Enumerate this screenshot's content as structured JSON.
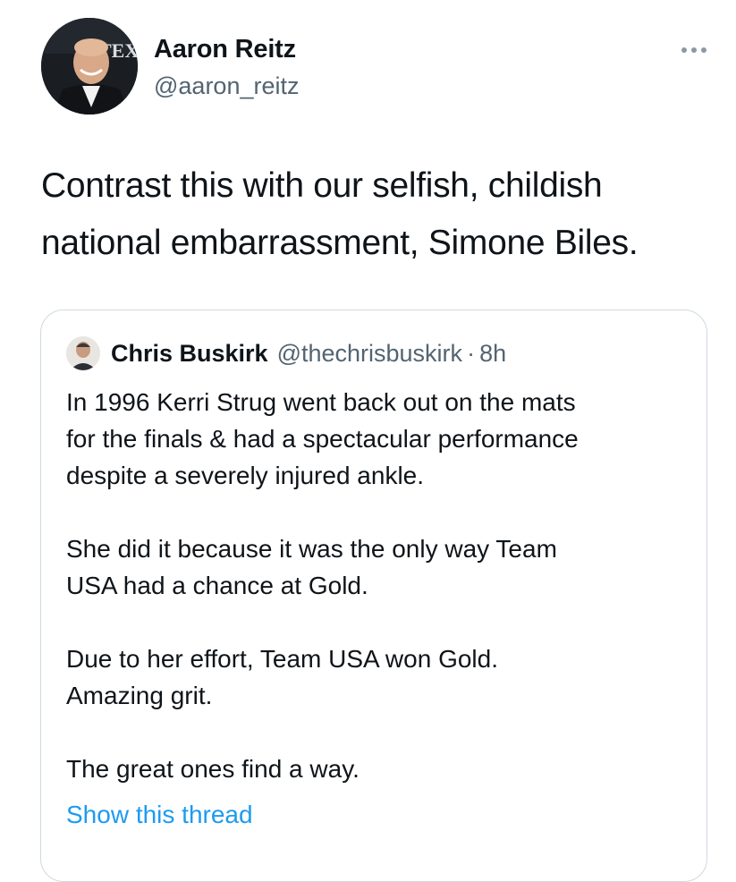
{
  "author": {
    "display_name": "Aaron Reitz",
    "handle": "@aaron_reitz",
    "avatar_backdrop_text": "TEX"
  },
  "more_icon": "more-horizontal-icon",
  "tweet": {
    "lines": [
      "Contrast this with our selfish, childish",
      "national embarrassment, Simone Biles."
    ]
  },
  "quoted_tweet": {
    "display_name": "Chris Buskirk",
    "handle": "@thechrisbuskirk",
    "separator": "·",
    "time": "8h",
    "paragraphs": [
      {
        "lines": [
          "In 1996 Kerri Strug went back out on the mats",
          "for the finals & had a spectacular performance",
          "despite a severely injured ankle."
        ]
      },
      {
        "lines": [
          "She did it because it was the only way Team",
          "USA had a chance at Gold."
        ]
      },
      {
        "lines": [
          "Due to her effort, Team USA won Gold.",
          "Amazing grit."
        ]
      },
      {
        "lines": [
          "The great ones find a way."
        ]
      }
    ],
    "show_thread_label": "Show this thread"
  },
  "colors": {
    "text_primary": "#0f1419",
    "text_secondary": "#536471",
    "link": "#1d9bf0",
    "border": "#cfd9de"
  }
}
